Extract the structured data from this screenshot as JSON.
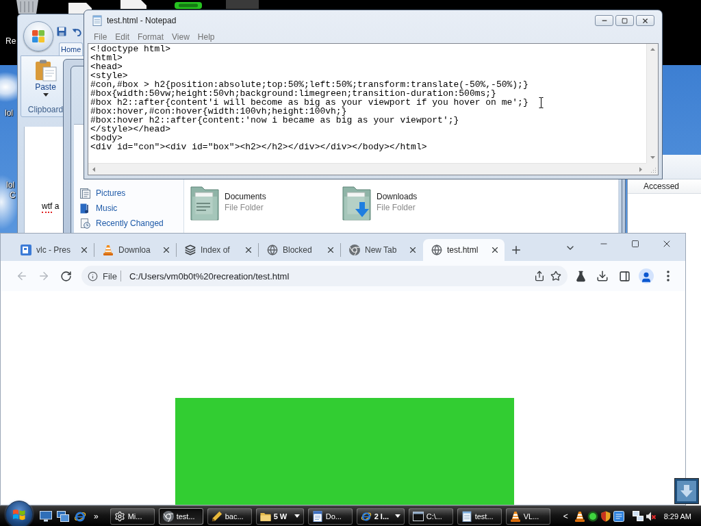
{
  "desktop": {
    "icon_labels": [
      "Re",
      "lol",
      "lol",
      "C"
    ]
  },
  "ribbon_window": {
    "ribbon_tab": "Home",
    "paste_label": "Paste",
    "group_label": "Clipboard",
    "document_words": [
      {
        "text": "wtf",
        "misspelled": true
      },
      {
        "text": "a",
        "misspelled": false
      }
    ]
  },
  "explorer": {
    "nav_items": [
      {
        "label": "Pictures",
        "kind": "pictures"
      },
      {
        "label": "Music",
        "kind": "music"
      },
      {
        "label": "Recently Changed",
        "kind": "recent"
      }
    ],
    "items": [
      {
        "name": "Documents",
        "type": "File Folder",
        "kind": "documents"
      },
      {
        "name": "Downloads",
        "type": "File Folder",
        "kind": "downloads"
      }
    ]
  },
  "details_pane": {
    "column_header": "Accessed"
  },
  "notepad": {
    "title": "test.html - Notepad",
    "menu": [
      "File",
      "Edit",
      "Format",
      "View",
      "Help"
    ],
    "lines": [
      "<!doctype html>",
      "<html>",
      "<head>",
      "<style>",
      "#con,#box > h2{position:absolute;top:50%;left:50%;transform:translate(-50%,-50%);}",
      "#box{width:50vw;height:50vh;background:limegreen;transition-duration:500ms;}",
      "#box h2::after{content'i will become as big as your viewport if you hover on me';}",
      "#box:hover,#con:hover{width:100vh;height:100vh;}",
      "#box:hover h2::after{content:'now i became as big as your viewport';}",
      "</style></head>",
      "<body>",
      "<div id=\"con\"><div id=\"box\"><h2></h2></div></div></body></html>"
    ]
  },
  "browser": {
    "tabs": [
      {
        "label": "vlc - Pres",
        "kind": "slides",
        "selected": false
      },
      {
        "label": "Downloa",
        "kind": "cone",
        "selected": false
      },
      {
        "label": "Index of",
        "kind": "stack",
        "selected": false
      },
      {
        "label": "Blocked",
        "kind": "globe",
        "selected": false
      },
      {
        "label": "New Tab",
        "kind": "logo",
        "selected": false
      },
      {
        "label": "test.html",
        "kind": "globe",
        "selected": true
      }
    ],
    "address": {
      "label": "File",
      "url": "C:/Users/vm0b0t%20recreation/test.html"
    }
  },
  "taskbar": {
    "overflow": "»",
    "tasks": [
      {
        "label": "Mi...",
        "kind": "gear",
        "selected": false,
        "grouped": false
      },
      {
        "label": "test...",
        "kind": "logo",
        "selected": true,
        "grouped": false
      },
      {
        "label": "bac...",
        "kind": "pen",
        "selected": false,
        "grouped": false
      },
      {
        "label": "5 W",
        "kind": "folder",
        "selected": false,
        "grouped": true
      },
      {
        "label": "Do...",
        "kind": "doc",
        "selected": false,
        "grouped": false
      },
      {
        "label": "2 I...",
        "kind": "browser",
        "selected": false,
        "grouped": true
      },
      {
        "label": "C:\\...",
        "kind": "console",
        "selected": false,
        "grouped": false
      },
      {
        "label": "test...",
        "kind": "notepad",
        "selected": false,
        "grouped": false
      },
      {
        "label": "VL...",
        "kind": "cone",
        "selected": false,
        "grouped": false
      }
    ],
    "tray_toggle": "<",
    "clock": "8:29 AM"
  }
}
